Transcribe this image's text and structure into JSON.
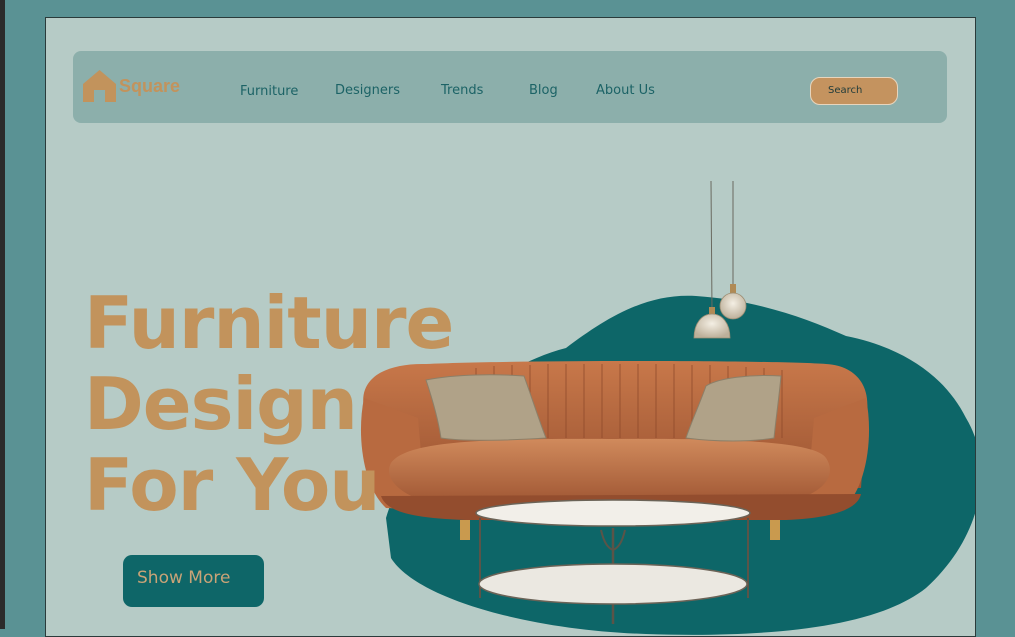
{
  "brand": {
    "name": "Square",
    "logo_icon": "house-icon"
  },
  "nav": {
    "items": [
      {
        "label": "Furniture"
      },
      {
        "label": "Designers"
      },
      {
        "label": "Trends"
      },
      {
        "label": "Blog"
      },
      {
        "label": "About Us"
      }
    ]
  },
  "search": {
    "label": "Search"
  },
  "hero": {
    "title_lines": [
      "Furniture",
      "Design",
      "For You"
    ],
    "cta_label": "Show More"
  },
  "colors": {
    "page_bg": "#5a9294",
    "canvas_bg": "#b6cbc6",
    "navbar_bg": "#8cafab",
    "accent": "#c2935c",
    "teal_dark": "#0e6668"
  }
}
